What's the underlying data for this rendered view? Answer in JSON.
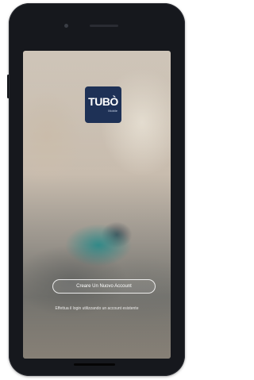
{
  "logo": {
    "brand": "TUBÒ",
    "sub": "Mobile"
  },
  "onboarding": {
    "create_account_label": "Creare Un Nuovo Account",
    "login_link_label": "Effettua il login utilizzando un account esistente"
  },
  "icons": {
    "front_camera": "camera-dot",
    "earpiece": "speaker-slot"
  },
  "colors": {
    "logo_background": "#1e3156",
    "device_frame": "#16181d",
    "accent_teal": "#2396a0"
  }
}
